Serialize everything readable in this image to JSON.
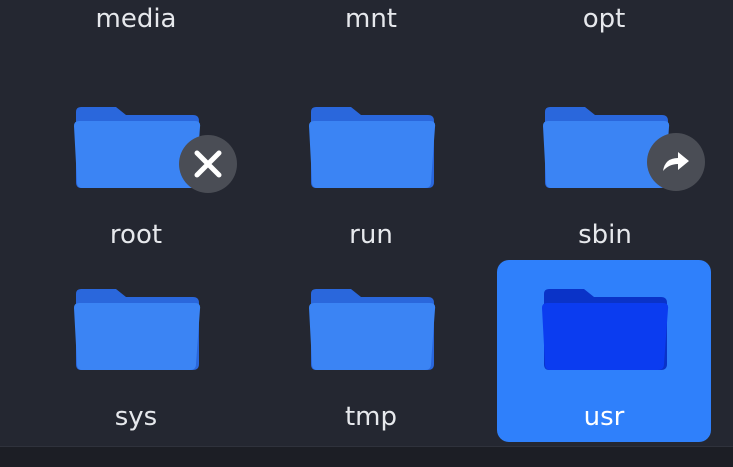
{
  "colors": {
    "background": "#242731",
    "folder_back": "#2a67dc",
    "folder_front": "#3b84f4",
    "selection": "#2f80fb",
    "selected_folder_back": "#0a33c8",
    "selected_folder_front": "#0b3cf0",
    "badge": "#4a4d55",
    "label_text": "#e6e8ec"
  },
  "top_row_labels": [
    "media",
    "mnt",
    "opt"
  ],
  "items": [
    {
      "name": "root",
      "icon": "folder-icon",
      "emblem": "unreadable-emblem-icon",
      "selected": false
    },
    {
      "name": "run",
      "icon": "folder-icon",
      "emblem": "",
      "selected": false
    },
    {
      "name": "sbin",
      "icon": "folder-icon",
      "emblem": "symlink-emblem-icon",
      "selected": false
    },
    {
      "name": "sys",
      "icon": "folder-icon",
      "emblem": "",
      "selected": false
    },
    {
      "name": "tmp",
      "icon": "folder-icon",
      "emblem": "",
      "selected": false
    },
    {
      "name": "usr",
      "icon": "folder-icon",
      "emblem": "",
      "selected": true
    }
  ]
}
